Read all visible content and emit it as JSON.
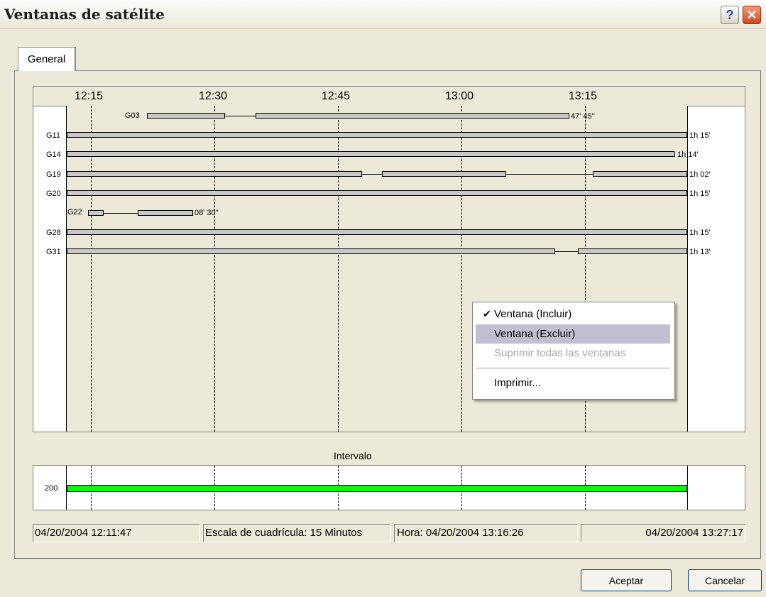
{
  "window": {
    "title": "Ventanas de satélite",
    "help_icon": "?",
    "close_icon": "✕"
  },
  "tab": {
    "label": "General"
  },
  "chart": {
    "time_ticks": [
      "12:15",
      "12:30",
      "12:45",
      "13:00",
      "13:15"
    ],
    "satellites": [
      {
        "name": "G03",
        "duration": "47' 45''"
      },
      {
        "name": "G11",
        "duration": "1h 15'"
      },
      {
        "name": "G14",
        "duration": "1h 14'"
      },
      {
        "name": "G19",
        "duration": "1h 02'"
      },
      {
        "name": "G20",
        "duration": "1h 15'"
      },
      {
        "name": "G22",
        "duration": "08' 30''"
      },
      {
        "name": "G28",
        "duration": "1h 15'"
      },
      {
        "name": "G31",
        "duration": "1h 13'"
      }
    ]
  },
  "interval": {
    "title": "Intervalo",
    "value_label": "200",
    "bar_color": "#00ff00"
  },
  "status": {
    "start": "04/20/2004 12:11:47",
    "grid_scale": "Escala de cuadrícula: 15 Minutos",
    "hora": "Hora: 04/20/2004 13:16:26",
    "end": "04/20/2004 13:27:17"
  },
  "context_menu": {
    "check_icon": "✔",
    "items": [
      {
        "label": "Ventana (Incluir)"
      },
      {
        "label": "Ventana (Excluir)"
      },
      {
        "label": "Suprimir todas las ventanas"
      },
      {
        "label": "Imprimir..."
      }
    ]
  },
  "buttons": {
    "ok": "Aceptar",
    "cancel": "Cancelar"
  }
}
